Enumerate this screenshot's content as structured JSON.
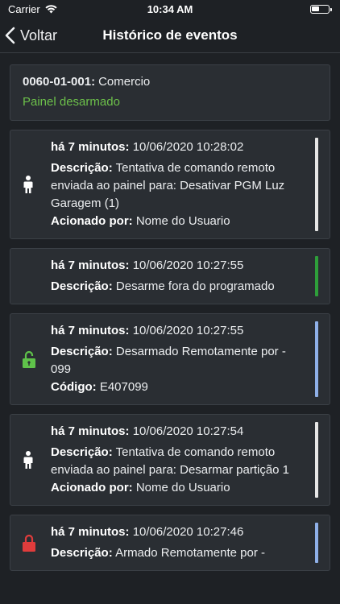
{
  "status_bar": {
    "carrier": "Carrier",
    "time": "10:34 AM",
    "battery_level": 0.45
  },
  "nav": {
    "back_label": "Voltar",
    "title": "Histórico de eventos"
  },
  "account": {
    "code": "0060-01-001:",
    "name": "Comercio",
    "status": "Painel desarmado",
    "status_color": "#6cc04a"
  },
  "events": [
    {
      "icon": "person-icon",
      "icon_color": "#ffffff",
      "bar_color": "#e6e6e6",
      "timestamp_label": "há 7 minutos:",
      "timestamp": "10/06/2020 10:28:02",
      "desc_label": "Descrição:",
      "desc": "Tentativa de comando remoto enviada ao painel para: Desativar PGM Luz Garagem (1)",
      "extra_label": "Acionado por:",
      "extra": "Nome do Usuario"
    },
    {
      "icon": "",
      "icon_color": "",
      "bar_color": "#2e9e3a",
      "timestamp_label": "há 7 minutos:",
      "timestamp": "10/06/2020 10:27:55",
      "desc_label": "Descrição:",
      "desc": "Desarme fora do programado",
      "extra_label": "",
      "extra": ""
    },
    {
      "icon": "unlock-icon",
      "icon_color": "#5fc24a",
      "bar_color": "#8fb0e8",
      "timestamp_label": "há 7 minutos:",
      "timestamp": "10/06/2020 10:27:55",
      "desc_label": "Descrição:",
      "desc": "Desarmado Remotamente por  - 099",
      "extra_label": "Código:",
      "extra": "E407099"
    },
    {
      "icon": "person-icon",
      "icon_color": "#ffffff",
      "bar_color": "#e6e6e6",
      "timestamp_label": "há 7 minutos:",
      "timestamp": "10/06/2020 10:27:54",
      "desc_label": "Descrição:",
      "desc": "Tentativa de comando remoto enviada ao painel para: Desarmar partição 1",
      "extra_label": "Acionado por:",
      "extra": "Nome do Usuario"
    },
    {
      "icon": "lock-icon",
      "icon_color": "#e03c3c",
      "bar_color": "#8fb0e8",
      "timestamp_label": "há 7 minutos:",
      "timestamp": "10/06/2020 10:27:46",
      "desc_label": "Descrição:",
      "desc": "Armado Remotamente por  -",
      "extra_label": "",
      "extra": ""
    }
  ]
}
